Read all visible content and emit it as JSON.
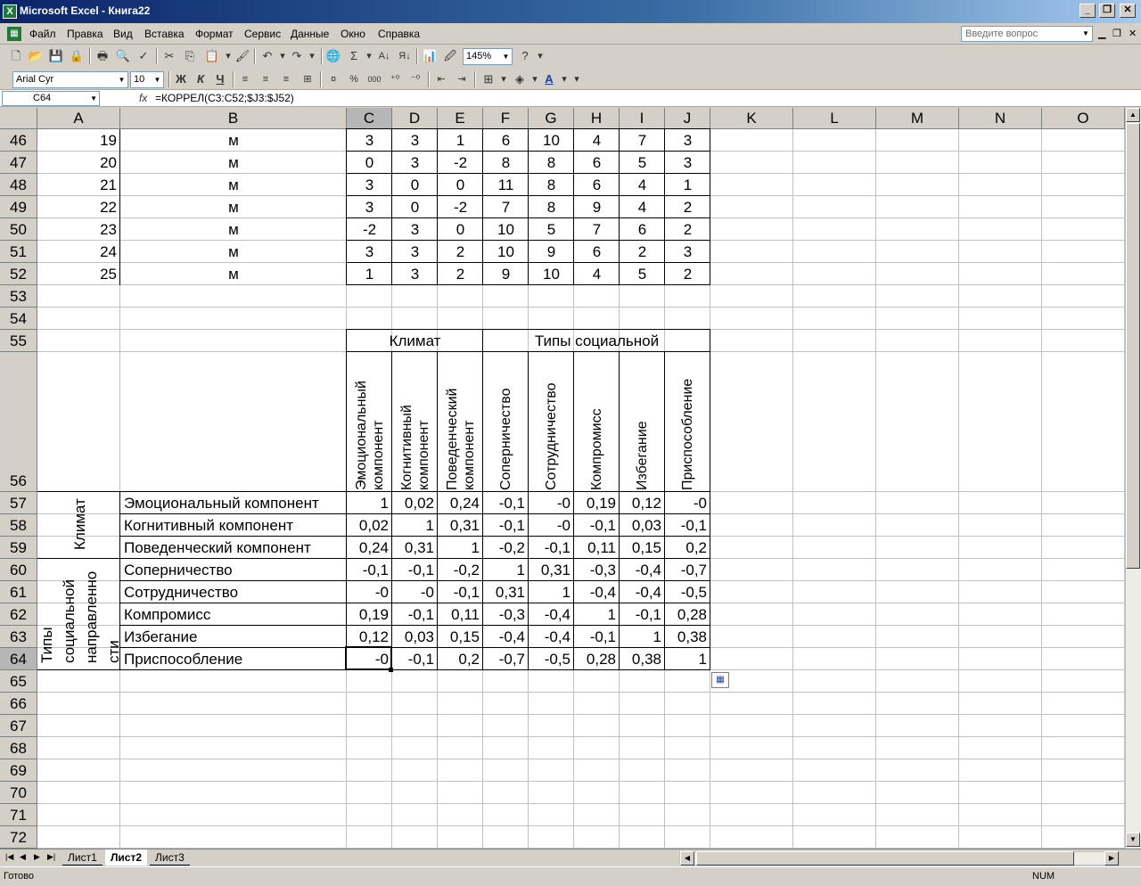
{
  "window": {
    "title": "Microsoft Excel - Книга22",
    "app_icon": "X"
  },
  "menu": {
    "items": [
      "Файл",
      "Правка",
      "Вид",
      "Вставка",
      "Формат",
      "Сервис",
      "Данные",
      "Окно",
      "Справка"
    ],
    "help_placeholder": "Введите вопрос"
  },
  "toolbar": {
    "zoom": "145%",
    "font_name": "Arial Cyr",
    "font_size": "10",
    "bold_label": "Ж",
    "italic_label": "К",
    "underline_label": "Ч",
    "percent_label": "%",
    "thousands_label": "000",
    "sum_label": "Σ",
    "font_color_label": "A"
  },
  "formula_bar": {
    "cell_ref": "C64",
    "fx_label": "fx",
    "formula": "=КОРРЕЛ(C3:C52;$J3:$J52)"
  },
  "columns": [
    "A",
    "B",
    "C",
    "D",
    "E",
    "F",
    "G",
    "H",
    "I",
    "J",
    "K",
    "L",
    "M",
    "N",
    "O"
  ],
  "rows": [
    "46",
    "47",
    "48",
    "49",
    "50",
    "51",
    "52",
    "53",
    "54",
    "55",
    "56",
    "57",
    "58",
    "59",
    "60",
    "61",
    "62",
    "63",
    "64",
    "65",
    "66",
    "67",
    "68",
    "69",
    "70",
    "71",
    "72"
  ],
  "data_rows": [
    {
      "a": "19",
      "b": "м",
      "vals": [
        "3",
        "3",
        "1",
        "6",
        "10",
        "4",
        "7",
        "3"
      ]
    },
    {
      "a": "20",
      "b": "м",
      "vals": [
        "0",
        "3",
        "-2",
        "8",
        "8",
        "6",
        "5",
        "3"
      ]
    },
    {
      "a": "21",
      "b": "м",
      "vals": [
        "3",
        "0",
        "0",
        "11",
        "8",
        "6",
        "4",
        "1"
      ]
    },
    {
      "a": "22",
      "b": "м",
      "vals": [
        "3",
        "0",
        "-2",
        "7",
        "8",
        "9",
        "4",
        "2"
      ]
    },
    {
      "a": "23",
      "b": "м",
      "vals": [
        "-2",
        "3",
        "0",
        "10",
        "5",
        "7",
        "6",
        "2"
      ]
    },
    {
      "a": "24",
      "b": "м",
      "vals": [
        "3",
        "3",
        "2",
        "10",
        "9",
        "6",
        "2",
        "3"
      ]
    },
    {
      "a": "25",
      "b": "м",
      "vals": [
        "1",
        "3",
        "2",
        "9",
        "10",
        "4",
        "5",
        "2"
      ]
    }
  ],
  "header_groups": {
    "climate": "Климат",
    "social": "Типы социальной"
  },
  "rotated_headers": [
    [
      "Эмоциональный",
      "компонент"
    ],
    [
      "Когнитивный",
      "компонент"
    ],
    [
      "Поведенческий",
      "компонент"
    ],
    [
      "Соперничество"
    ],
    [
      "Сотрудничество"
    ],
    [
      "Компромисс"
    ],
    [
      "Избегание"
    ],
    [
      "Приспособление"
    ]
  ],
  "row_groups": {
    "climate": "Климат",
    "social": [
      "Типы",
      "социальной",
      "направленно",
      "сти"
    ]
  },
  "matrix": [
    {
      "label": "Эмоциональный компонент",
      "vals": [
        "1",
        "0,02",
        "0,24",
        "-0,1",
        "-0",
        "0,19",
        "0,12",
        "-0"
      ]
    },
    {
      "label": "Когнитивный компонент",
      "vals": [
        "0,02",
        "1",
        "0,31",
        "-0,1",
        "-0",
        "-0,1",
        "0,03",
        "-0,1"
      ]
    },
    {
      "label": "Поведенческий компонент",
      "vals": [
        "0,24",
        "0,31",
        "1",
        "-0,2",
        "-0,1",
        "0,11",
        "0,15",
        "0,2"
      ]
    },
    {
      "label": "Соперничество",
      "vals": [
        "-0,1",
        "-0,1",
        "-0,2",
        "1",
        "0,31",
        "-0,3",
        "-0,4",
        "-0,7"
      ]
    },
    {
      "label": "Сотрудничество",
      "vals": [
        "-0",
        "-0",
        "-0,1",
        "0,31",
        "1",
        "-0,4",
        "-0,4",
        "-0,5"
      ]
    },
    {
      "label": "Компромисс",
      "vals": [
        "0,19",
        "-0,1",
        "0,11",
        "-0,3",
        "-0,4",
        "1",
        "-0,1",
        "0,28"
      ]
    },
    {
      "label": "Избегание",
      "vals": [
        "0,12",
        "0,03",
        "0,15",
        "-0,4",
        "-0,4",
        "-0,1",
        "1",
        "0,38"
      ]
    },
    {
      "label": "Приспособление",
      "vals": [
        "-0",
        "-0,1",
        "0,2",
        "-0,7",
        "-0,5",
        "0,28",
        "0,38",
        "1"
      ]
    }
  ],
  "sheets": [
    "Лист1",
    "Лист2",
    "Лист3"
  ],
  "active_sheet": "Лист2",
  "status": {
    "text": "Готово",
    "num": "NUM"
  }
}
